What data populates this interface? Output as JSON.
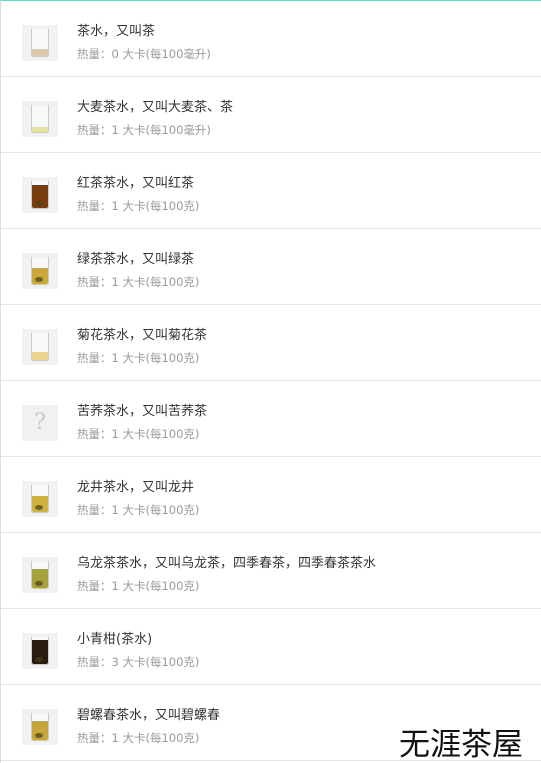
{
  "items": [
    {
      "name": "茶水，又叫茶",
      "calories": "热量：0 大卡(每100毫升)",
      "icon": "clear-tea-glass-icon",
      "liquid_color": "#d9c9a8",
      "fill": 0.25
    },
    {
      "name": "大麦茶水，又叫大麦茶、茶",
      "calories": "热量：1 大卡(每100毫升)",
      "icon": "barley-tea-glass-icon",
      "liquid_color": "#e8e2a0",
      "fill": 0.2
    },
    {
      "name": "红茶茶水，又叫红茶",
      "calories": "热量：1 大卡(每100克)",
      "icon": "black-tea-glass-icon",
      "liquid_color": "#7a3e0e",
      "fill": 0.85
    },
    {
      "name": "绿茶茶水，又叫绿茶",
      "calories": "热量：1 大卡(每100克)",
      "icon": "green-tea-glass-icon",
      "liquid_color": "#c9a93a",
      "fill": 0.6
    },
    {
      "name": "菊花茶水，又叫菊花茶",
      "calories": "热量：1 大卡(每100克)",
      "icon": "chrysanthemum-tea-glass-icon",
      "liquid_color": "#ecd48a",
      "fill": 0.3
    },
    {
      "name": "苦荞茶水，又叫苦荞茶",
      "calories": "热量：1 大卡(每100克)",
      "icon": "question-placeholder-icon",
      "liquid_color": "",
      "fill": 0
    },
    {
      "name": "龙井茶水，又叫龙井",
      "calories": "热量：1 大卡(每100克)",
      "icon": "longjing-tea-glass-icon",
      "liquid_color": "#cdb33e",
      "fill": 0.6
    },
    {
      "name": "乌龙茶茶水，又叫乌龙茶，四季春茶，四季春茶茶水",
      "calories": "热量：1 大卡(每100克)",
      "icon": "oolong-tea-glass-icon",
      "liquid_color": "#a5a23a",
      "fill": 0.7
    },
    {
      "name": "小青柑(茶水)",
      "calories": "热量：3 大卡(每100克)",
      "icon": "xiaoqinggan-tea-glass-icon",
      "liquid_color": "#2a1a10",
      "fill": 0.9
    },
    {
      "name": "碧螺春茶水，又叫碧螺春",
      "calories": "热量：1 大卡(每100克)",
      "icon": "biluochun-tea-glass-icon",
      "liquid_color": "#c6a63a",
      "fill": 0.7
    }
  ],
  "watermark": "无涯茶屋",
  "placeholder_glyph": "?"
}
